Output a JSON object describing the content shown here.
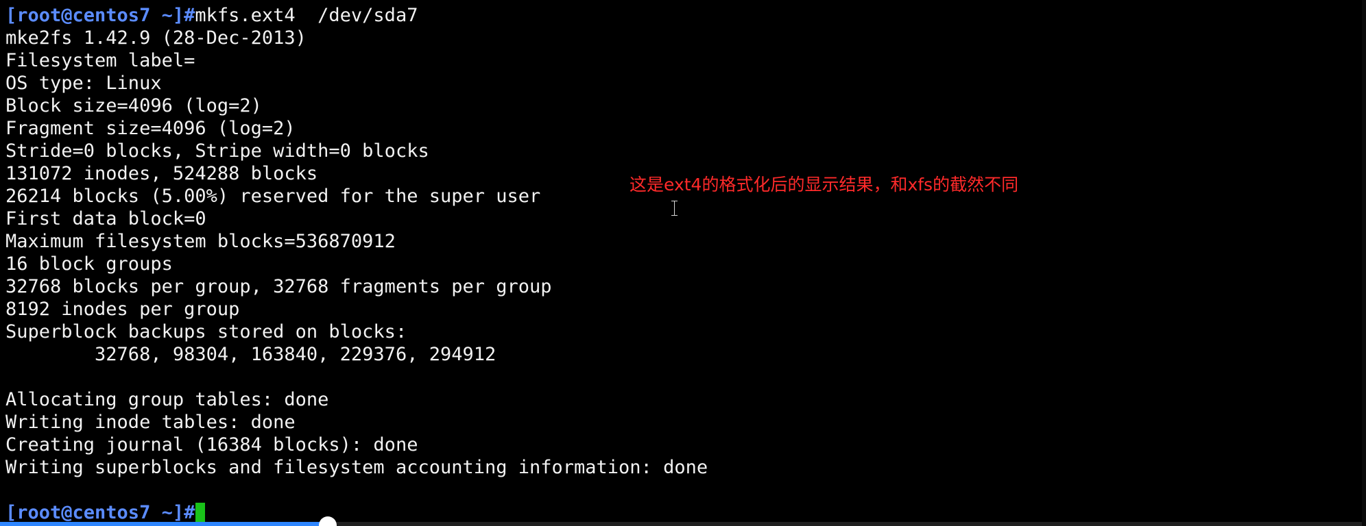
{
  "terminal": {
    "lines": [
      {
        "prompt": "[root@centos7 ~]#",
        "text": "mkfs.ext4  /dev/sda7"
      },
      {
        "text": "mke2fs 1.42.9 (28-Dec-2013)"
      },
      {
        "text": "Filesystem label="
      },
      {
        "text": "OS type: Linux"
      },
      {
        "text": "Block size=4096 (log=2)"
      },
      {
        "text": "Fragment size=4096 (log=2)"
      },
      {
        "text": "Stride=0 blocks, Stripe width=0 blocks"
      },
      {
        "text": "131072 inodes, 524288 blocks"
      },
      {
        "text": "26214 blocks (5.00%) reserved for the super user"
      },
      {
        "text": "First data block=0"
      },
      {
        "text": "Maximum filesystem blocks=536870912"
      },
      {
        "text": "16 block groups"
      },
      {
        "text": "32768 blocks per group, 32768 fragments per group"
      },
      {
        "text": "8192 inodes per group"
      },
      {
        "text": "Superblock backups stored on blocks:"
      },
      {
        "text": "        32768, 98304, 163840, 229376, 294912"
      },
      {
        "text": ""
      },
      {
        "text": "Allocating group tables: done"
      },
      {
        "text": "Writing inode tables: done"
      },
      {
        "text": "Creating journal (16384 blocks): done"
      },
      {
        "text": "Writing superblocks and filesystem accounting information: done"
      },
      {
        "text": ""
      },
      {
        "prompt": "[root@centos7 ~]#",
        "text": "",
        "cursor": true
      }
    ]
  },
  "annotation": {
    "text": "这是ext4的格式化后的显示结果，和xfs的截然不同"
  },
  "video_progress": {
    "played_fraction": 0.24
  },
  "colors": {
    "background": "#000000",
    "foreground": "#f2f2f2",
    "prompt": "#5b8cff",
    "cursor": "#19c219",
    "annotation": "#ff2a2a",
    "progress": "#2e86ff"
  }
}
